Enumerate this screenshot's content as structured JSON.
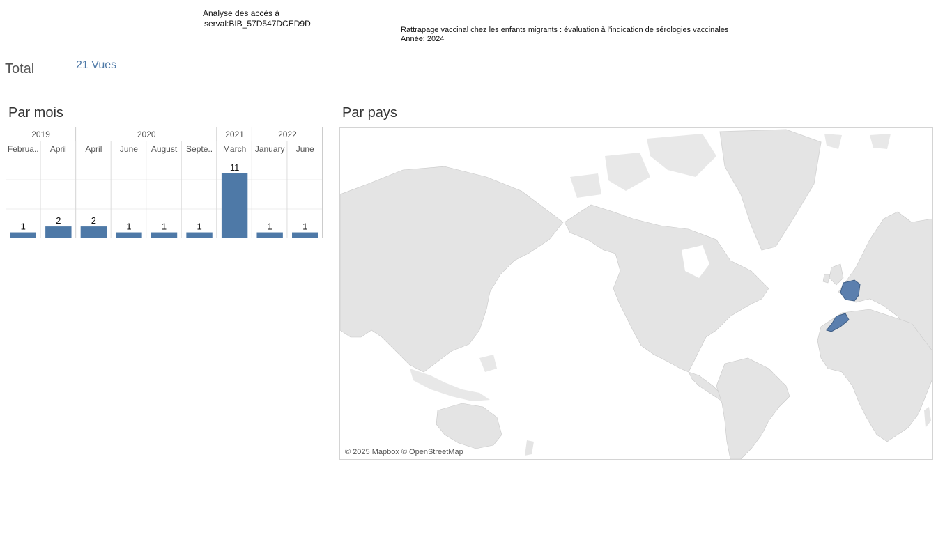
{
  "header": {
    "analysis_line1": "Analyse des accès à",
    "analysis_line2": "serval:BIB_57D547DCED9D",
    "doc_title": "Rattrapage vaccinal chez les enfants migrants : évaluation à l'indication de sérologies vaccinales",
    "doc_year": "Année: 2024"
  },
  "total": {
    "label": "Total",
    "value": "21 Vues"
  },
  "sections": {
    "by_month": "Par mois",
    "by_country": "Par pays"
  },
  "chart_data": {
    "type": "bar",
    "years": [
      {
        "label": "2019",
        "span": 2
      },
      {
        "label": "2020",
        "span": 4
      },
      {
        "label": "2021",
        "span": 1
      },
      {
        "label": "2022",
        "span": 2
      }
    ],
    "categories": [
      "Februa..",
      "April",
      "April",
      "June",
      "August",
      "Septe..",
      "March",
      "January",
      "June"
    ],
    "values": [
      1,
      2,
      2,
      1,
      1,
      1,
      11,
      1,
      1
    ],
    "ylim": [
      0,
      11
    ],
    "bar_color": "#4e79a7",
    "grid": true
  },
  "map": {
    "attribution": "© 2025 Mapbox © OpenStreetMap",
    "land_color": "#e4e4e4",
    "highlight_color": "#5b7fae",
    "highlighted_countries": [
      "France",
      "Morocco"
    ]
  }
}
